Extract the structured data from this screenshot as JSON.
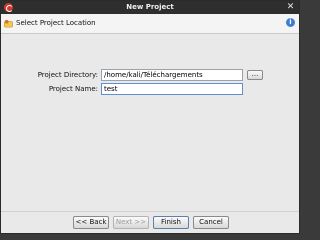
{
  "window": {
    "title": "New Project"
  },
  "header": {
    "step_title": "Select Project Location"
  },
  "form": {
    "directory_label": "Project Directory:",
    "directory_value": "/home/kali/Téléchargements",
    "browse_label": "...",
    "name_label": "Project Name:",
    "name_value": "test"
  },
  "buttons": {
    "back": "<< Back",
    "next": "Next >>",
    "finish": "Finish",
    "cancel": "Cancel"
  },
  "icons": {
    "app": "app-logo-icon",
    "step": "folder-star-icon",
    "info": "info-icon",
    "close": "close-icon"
  }
}
